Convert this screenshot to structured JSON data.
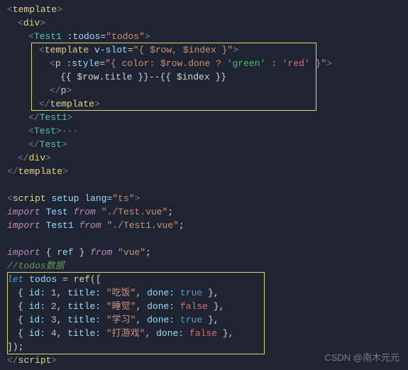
{
  "tags": {
    "template": "template",
    "div": "div",
    "test1": "Test1",
    "test": "Test",
    "p": "p",
    "script": "script"
  },
  "attrs": {
    "todos_attr": ":todos",
    "todos_val": "\"todos\"",
    "vslot_attr": "v-slot",
    "vslot_val": "\"{ $row, $index }\"",
    "style_attr": ":style",
    "style_open": "\"{ color: $row.done ? ",
    "style_green": "'green'",
    "style_mid": " : ",
    "style_red": "'red'",
    "style_close": " }\"",
    "interp": "{{ $row.title }}--{{ $index }}",
    "dots": "···"
  },
  "script_tag": {
    "setup": "setup",
    "lang_attr": "lang",
    "lang_val": "\"ts\""
  },
  "imports": {
    "kw_import": "import",
    "kw_from": "from",
    "name_test": "Test",
    "path_test": "\"./Test.vue\"",
    "name_test1": "Test1",
    "path_test1": "\"./Test1.vue\"",
    "ref": "ref",
    "vue": "\"vue\"",
    "brace_open": "{ ",
    "brace_close": " }"
  },
  "todos_block": {
    "comment": "//todos数据",
    "let": "let",
    "name": "todos",
    "eq": " = ",
    "ref_fn": "ref",
    "open": "([",
    "close_arr": "]);",
    "rows": [
      {
        "id_lbl": "id:",
        "id": "1",
        "title_lbl": "title:",
        "title": "\"吃饭\"",
        "done_lbl": "done:",
        "done": "true"
      },
      {
        "id_lbl": "id:",
        "id": "2",
        "title_lbl": "title:",
        "title": "\"睡觉\"",
        "done_lbl": "done:",
        "done": "false"
      },
      {
        "id_lbl": "id:",
        "id": "3",
        "title_lbl": "title:",
        "title": "\"学习\"",
        "done_lbl": "done:",
        "done": "true"
      },
      {
        "id_lbl": "id:",
        "id": "4",
        "title_lbl": "title:",
        "title": "\"打游戏\"",
        "done_lbl": "done:",
        "done": "false"
      }
    ]
  },
  "watermark": "CSDN @南木元元"
}
